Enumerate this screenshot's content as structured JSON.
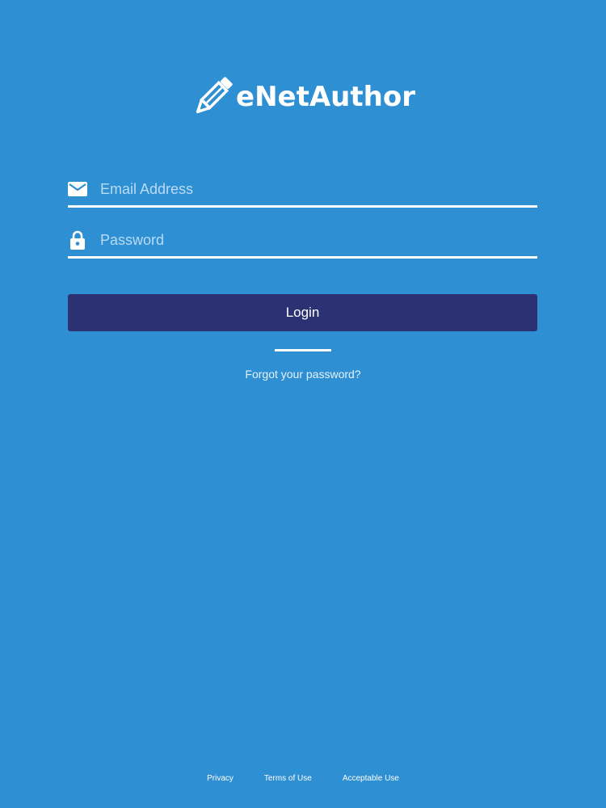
{
  "brand": {
    "name": "eNetAuthor",
    "icon": "pencil-icon"
  },
  "login_form": {
    "email": {
      "icon": "envelope-icon",
      "placeholder": "Email Address",
      "value": ""
    },
    "password": {
      "icon": "lock-icon",
      "placeholder": "Password",
      "value": ""
    },
    "login_label": "Login",
    "forgot_label": "Forgot your password?"
  },
  "footer": {
    "links": [
      "Privacy",
      "Terms of Use",
      "Acceptable Use"
    ]
  },
  "colors": {
    "background": "#2e8fd3",
    "button": "#2b3173",
    "text": "#ffffff"
  }
}
